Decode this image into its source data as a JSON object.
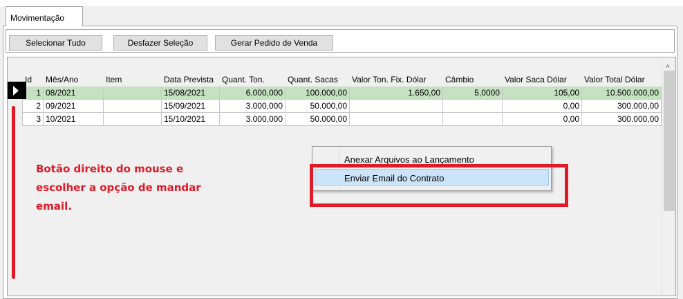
{
  "tabs": [
    {
      "label": "Movimentação"
    }
  ],
  "toolbar": {
    "select_all": "Selecionar Tudo",
    "undo_selection": "Desfazer Seleção",
    "generate_order": "Gerar  Pedido de Venda"
  },
  "grid": {
    "columns": [
      "Id",
      "Mês/Ano",
      "Item",
      "Data Prevista",
      "Quant. Ton.",
      "Quant. Sacas",
      "Valor Ton. Fix. Dólar",
      "Câmbio",
      "Valor Saca Dólar",
      "Valor Total Dólar"
    ],
    "rows": [
      [
        "1",
        "08/2021",
        "",
        "15/08/2021",
        "6.000,000",
        "100.000,00",
        "1.650,00",
        "5,0000",
        "105,00",
        "10.500.000,00"
      ],
      [
        "2",
        "09/2021",
        "",
        "15/09/2021",
        "3.000,000",
        "50.000,00",
        "",
        "",
        "0,00",
        "300.000,00"
      ],
      [
        "3",
        "10/2021",
        "",
        "15/10/2021",
        "3.000,000",
        "50.000,00",
        "",
        "",
        "0,00",
        "300.000,00"
      ]
    ],
    "selected_row": 0,
    "scroll_up_icon": "chevron-up-icon"
  },
  "context_menu": {
    "items": [
      "Anexar Arquivos ao Lançamento",
      "Enviar Email do Contrato"
    ],
    "highlighted": 1
  },
  "annotation": {
    "lines": [
      "Botão direito do mouse e",
      "escolher a opção de mandar",
      "email."
    ],
    "color": "#e11a27"
  },
  "colors": {
    "selected_row": "#c6e0c2",
    "menu_highlight": "#cce4f7"
  }
}
